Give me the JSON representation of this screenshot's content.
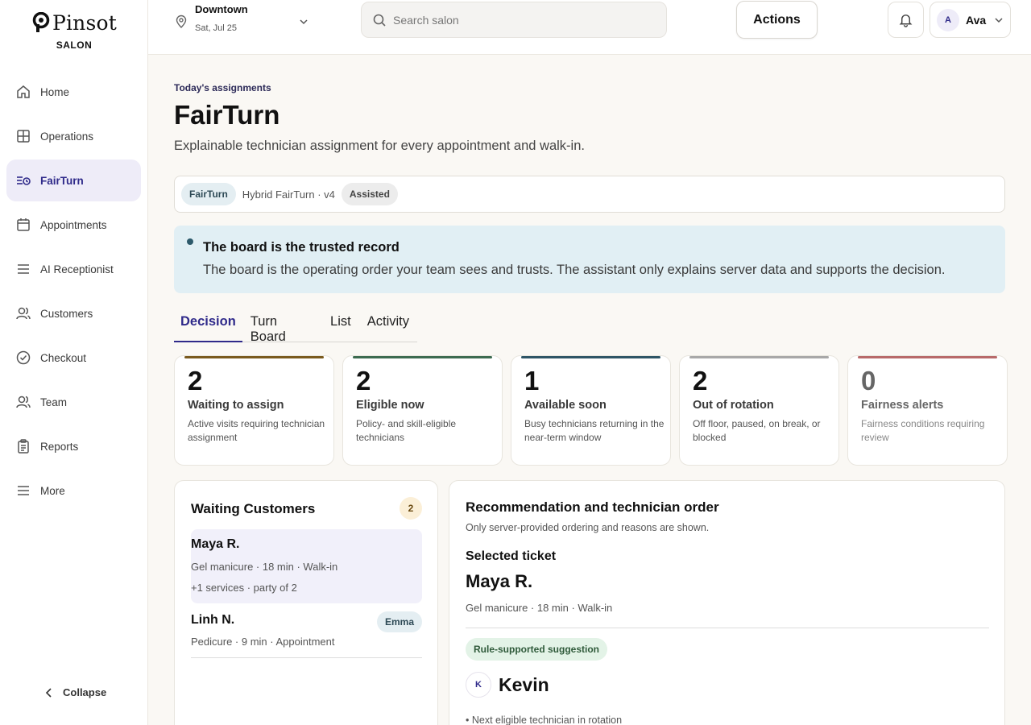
{
  "brand": {
    "name": "Pinsot",
    "sub": "SALON"
  },
  "sidebar": {
    "items": [
      {
        "label": "Home",
        "icon": "home-icon"
      },
      {
        "label": "Operations",
        "icon": "grid-icon"
      },
      {
        "label": "FairTurn",
        "icon": "turn-list-icon",
        "active": true
      },
      {
        "label": "Appointments",
        "icon": "calendar-icon"
      },
      {
        "label": "AI Receptionist",
        "icon": "menu-lines-icon"
      },
      {
        "label": "Customers",
        "icon": "users-icon"
      },
      {
        "label": "Checkout",
        "icon": "check-circle-icon"
      },
      {
        "label": "Team",
        "icon": "team-icon"
      },
      {
        "label": "Reports",
        "icon": "clipboard-icon"
      },
      {
        "label": "More",
        "icon": "menu-lines-icon"
      }
    ],
    "collapse_label": "Collapse"
  },
  "header": {
    "location": "Downtown",
    "date": "Sat, Jul 25",
    "search_placeholder": "Search salon",
    "actions_label": "Actions",
    "user_initial": "A",
    "user_name": "Ava"
  },
  "page": {
    "eyebrow": "Today's assignments",
    "title": "FairTurn",
    "subtitle": "Explainable technician assignment for every appointment and walk-in.",
    "policy": {
      "badge": "FairTurn",
      "text": "Hybrid FairTurn · v4",
      "mode": "Assisted"
    },
    "notice": {
      "title": "The board is the trusted record",
      "body": "The board is the operating order your team sees and trusts. The assistant only explains server data and supports the decision."
    },
    "tabs": [
      "Decision",
      "Turn Board",
      "List",
      "Activity"
    ],
    "stats": [
      {
        "num": "2",
        "label": "Waiting to assign",
        "desc": "Active visits requiring technician assignment",
        "color": "#7a5a1e"
      },
      {
        "num": "2",
        "label": "Eligible now",
        "desc": "Policy- and skill-eligible technicians",
        "color": "#3d6b50"
      },
      {
        "num": "1",
        "label": "Available soon",
        "desc": "Busy technicians returning in the near-term window",
        "color": "#2e5566"
      },
      {
        "num": "2",
        "label": "Out of rotation",
        "desc": "Off floor, paused, on break, or blocked",
        "color": "#a8a8a8"
      },
      {
        "num": "0",
        "label": "Fairness alerts",
        "desc": "Fairness conditions requiring review",
        "color": "#b86a6a"
      }
    ],
    "waiting": {
      "title": "Waiting Customers",
      "count": "2",
      "customers": [
        {
          "name": "Maya R.",
          "meta": "Gel manicure · 18 min · Walk-in",
          "extra": "+1 services · party of 2"
        },
        {
          "name": "Linh N.",
          "meta": "Pedicure · 9 min · Appointment",
          "tech": "Emma"
        }
      ]
    },
    "reco": {
      "title": "Recommendation and technician order",
      "sub": "Only server-provided ordering and reasons are shown.",
      "selected_label": "Selected ticket",
      "selected_name": "Maya R.",
      "selected_meta": "Gel manicure · 18 min · Walk-in",
      "suggestion": "Rule-supported suggestion",
      "tech_initial": "K",
      "tech_name": "Kevin",
      "reason": "• Next eligible technician in rotation"
    }
  }
}
